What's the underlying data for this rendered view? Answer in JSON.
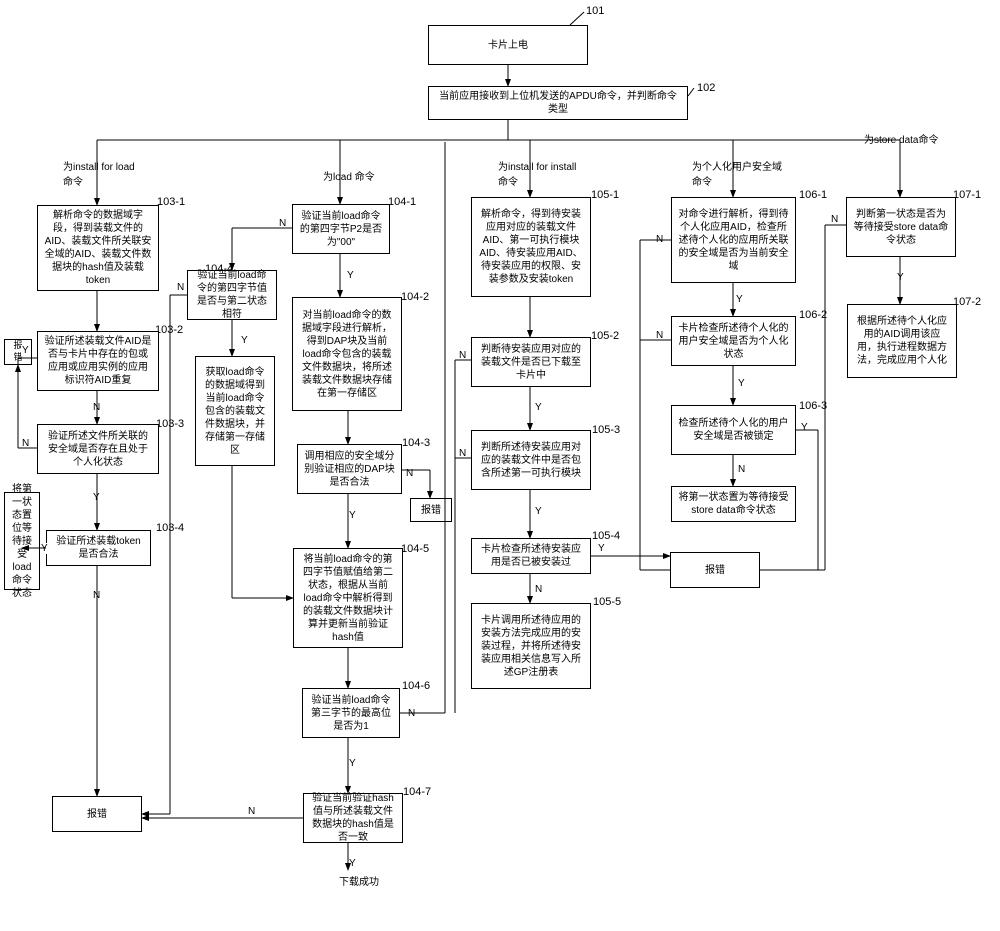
{
  "refs": {
    "r101": "101",
    "r102": "102",
    "r103_1": "103-1",
    "r103_2": "103-2",
    "r103_3": "103-3",
    "r103_4": "103-4",
    "r104_1": "104-1",
    "r104_2": "104-2",
    "r104_3": "104-3",
    "r104_4": "104-4",
    "r104_5": "104-5",
    "r104_6": "104-6",
    "r104_7": "104-7",
    "r105_1": "105-1",
    "r105_2": "105-2",
    "r105_3": "105-3",
    "r105_4": "105-4",
    "r105_5": "105-5",
    "r106_1": "106-1",
    "r106_2": "106-2",
    "r106_3": "106-3",
    "r107_1": "107-1",
    "r107_2": "107-2"
  },
  "nodes": {
    "n101": "卡片上电",
    "n102": "当前应用接收到上位机发送的APDU命令，并判断命令类型",
    "branch_install_for_load": "为install for load命令",
    "branch_load": "为load 命令",
    "branch_install_for_install": "为install for install命令",
    "branch_personalize": "为个人化用户安全域命令",
    "branch_store_data": "为store data命令",
    "n103_1": "解析命令的数据域字段，得到装载文件的AID、装载文件所关联安全域的AID、装载文件数据块的hash值及装载token",
    "n103_2": "验证所述装载文件AID是否与卡片中存在的包或应用或应用实例的应用标识符AID重复",
    "n103_3": "验证所述文件所关联的安全域是否存在且处于个人化状态",
    "n103_4": "验证所述装载token是否合法",
    "set_state_load": "将第一状态置位等待接受load命令状态",
    "error1": "报错",
    "error_left": "报错",
    "n104_1": "验证当前load命令的第四字节P2是否为\"00\"",
    "n104_2": "对当前load命令的数据域字段进行解析，得到DAP块及当前load命令包含的装载文件数据块，将所述装载文件数据块存储在第一存储区",
    "n104_3": "调用相应的安全域分别验证相应的DAP块是否合法",
    "n104_4": "验证当前load命令的第四字节值是否与第二状态相符",
    "get_load_data": "获取load命令的数据域得到当前load命令包含的装载文件数据块，并存储第一存储区",
    "error_mid": "报错",
    "n104_5": "将当前load命令的第四字节值赋值给第二状态，根据从当前load命令中解析得到的装载文件数据块计算并更新当前验证hash值",
    "n104_6": "验证当前load命令第三字节的最高位是否为1",
    "n104_7": "验证当前验证hash值与所述装载文件数据块的hash值是否一致",
    "download_ok": "下载成功",
    "n105_1": "解析命令，得到待安装应用对应的装载文件AID、第一可执行模块AID、待安装应用AID、待安装应用的权限、安装参数及安装token",
    "n105_2": "判断待安装应用对应的装载文件是否已下载至卡片中",
    "n105_3": "判断所述待安装应用对应的装载文件中是否包含所述第一可执行模块",
    "n105_4": "卡片检查所述待安装应用是否已被安装过",
    "n105_5": "卡片调用所述待应用的安装方法完成应用的安装过程，并将所述待安装应用相关信息写入所述GP注册表",
    "error_install": "报错",
    "n106_1": "对命令进行解析，得到待个人化应用AID，检查所述待个人化的应用所关联的安全域是否为当前安全域",
    "n106_2": "卡片检查所述待个人化的用户安全域是否为个人化状态",
    "n106_3": "检查所述待个人化的用户安全域是否被锁定",
    "set_state_store": "将第一状态置为等待接受store data命令状态",
    "n107_1": "判断第一状态是否为等待接受store data命令状态",
    "n107_2": "根据所述待个人化应用的AID调用该应用，执行进程数据方法，完成应用个人化"
  },
  "edges": {
    "Y": "Y",
    "N": "N"
  }
}
